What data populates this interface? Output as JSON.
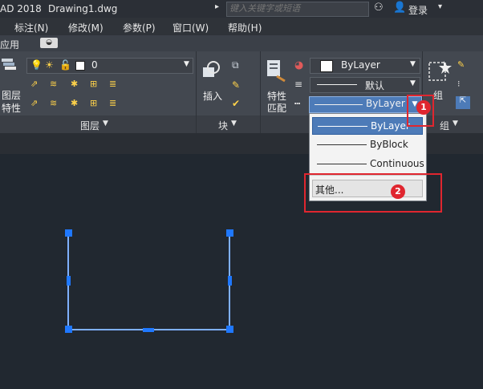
{
  "titlebar": {
    "app_title": "AD 2018",
    "document": "Drawing1.dwg",
    "search_placeholder": "键入关键字或短语",
    "login": "登录"
  },
  "menubar": {
    "items": [
      "标注(N)",
      "修改(M)",
      "参数(P)",
      "窗口(W)",
      "帮助(H)"
    ]
  },
  "tabrow": {
    "first_tab": "应用"
  },
  "ribbon": {
    "layer_combo_value": "0",
    "layer_props_label_1": "图层",
    "layer_props_label_2": "特性",
    "insert_label": "插入",
    "match_label_1": "特性",
    "match_label_2": "匹配",
    "color_value": "ByLayer",
    "lineweight_value": "默认",
    "linetype_value": "ByLayer",
    "group_label": "组"
  },
  "panels": {
    "layers": "图层",
    "block": "块",
    "group": "组"
  },
  "linetype_dropdown": {
    "items": [
      "ByLayer",
      "ByBlock",
      "Continuous"
    ],
    "other": "其他..."
  },
  "annotations": {
    "badge_1": "1",
    "badge_2": "2"
  },
  "colors": {
    "accent_red": "#e0262f",
    "grip_blue": "#1f78ff",
    "selection_blue": "#4d7bb8"
  }
}
